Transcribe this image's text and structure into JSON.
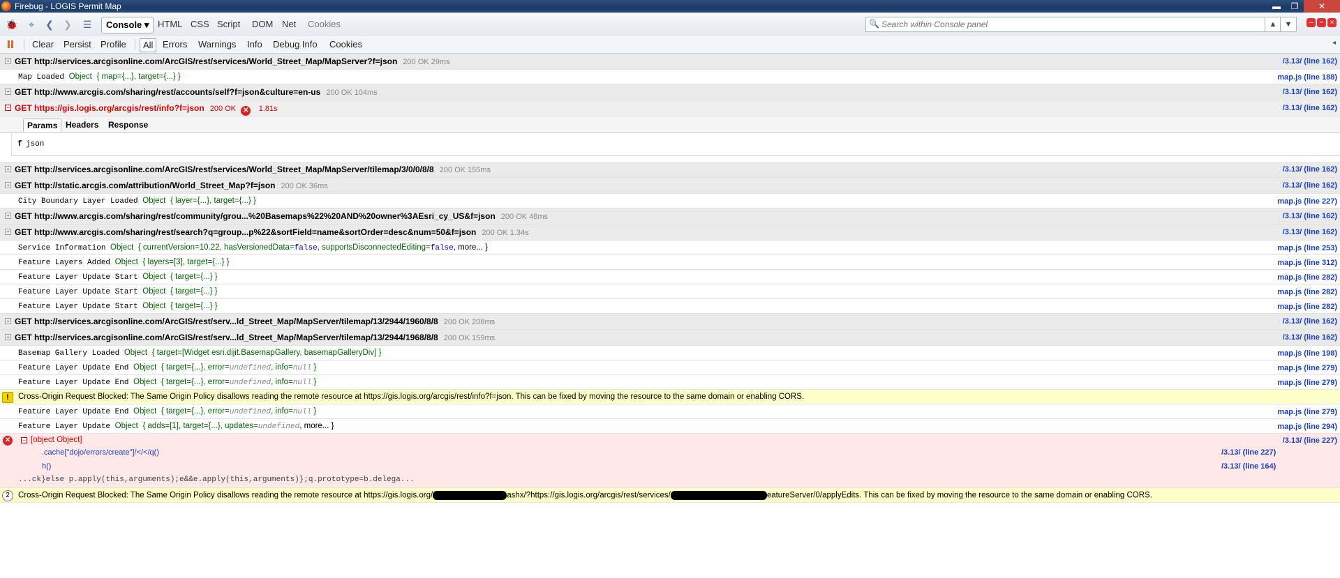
{
  "window": {
    "title": "Firebug - LOGIS Permit Map",
    "min": "▬",
    "max": "❐",
    "close": "✕"
  },
  "toolbar": {
    "tabs": [
      "Console",
      "HTML",
      "CSS",
      "Script",
      "DOM",
      "Net",
      "Cookies"
    ],
    "console_dropdown": "▾",
    "search_placeholder": "Search within Console panel"
  },
  "console_toolbar": {
    "buttons": [
      "Clear",
      "Persist",
      "Profile"
    ],
    "filters": [
      "All",
      "Errors",
      "Warnings",
      "Info",
      "Debug Info",
      "Cookies"
    ]
  },
  "log": {
    "req1": {
      "text": "GET http://services.arcgisonline.com/ArcGIS/rest/services/World_Street_Map/MapServer?f=json",
      "status": "200 OK 29ms",
      "src": "/3.13/ (line 162)"
    },
    "log_map_loaded": {
      "msg": "Map Loaded",
      "obj": "Object",
      "props": "{ map={...}, target={...} }",
      "src": "map.js (line 188)"
    },
    "req2": {
      "text": "GET http://www.arcgis.com/sharing/rest/accounts/self?f=json&culture=en-us",
      "status": "200 OK 104ms",
      "src": "/3.13/ (line 162)"
    },
    "req3": {
      "text": "GET https://gis.logis.org/arcgis/rest/info?f=json",
      "status": "200 OK",
      "time": "1.81s",
      "src": "/3.13/ (line 162)"
    },
    "req3_tabs": [
      "Params",
      "Headers",
      "Response"
    ],
    "req3_param_key": "f",
    "req3_param_val": "json",
    "req4": {
      "text": "GET http://services.arcgisonline.com/ArcGIS/rest/services/World_Street_Map/MapServer/tilemap/3/0/0/8/8",
      "status": "200 OK 155ms",
      "src": "/3.13/ (line 162)"
    },
    "req5": {
      "text": "GET http://static.arcgis.com/attribution/World_Street_Map?f=json",
      "status": "200 OK 36ms",
      "src": "/3.13/ (line 162)"
    },
    "log_city": {
      "msg": "City Boundary Layer Loaded",
      "obj": "Object",
      "props": "{ layer={...}, target={...} }",
      "src": "map.js (line 227)"
    },
    "req6": {
      "text": "GET http://www.arcgis.com/sharing/rest/community/grou...%20Basemaps%22%20AND%20owner%3AEsri_cy_US&f=json",
      "status": "200 OK 48ms",
      "src": "/3.13/ (line 162)"
    },
    "req7": {
      "text": "GET http://www.arcgis.com/sharing/rest/search?q=group...p%22&sortField=name&sortOrder=desc&num=50&f=json",
      "status": "200 OK 1.34s",
      "src": "/3.13/ (line 162)"
    },
    "log_service": {
      "msg": "Service Information",
      "obj": "Object",
      "props_a": "{ currentVersion=10.22, hasVersionedData=",
      "f1": "false",
      "props_b": ", supportsDisconnectedEditing=",
      "f2": "false",
      "more": ", more... }",
      "src": "map.js (line 253)"
    },
    "log_fl_added": {
      "msg": "Feature Layers Added",
      "obj": "Object",
      "props": "{ layers=[3], target={...} }",
      "src": "map.js (line 312)"
    },
    "log_flus1": {
      "msg": "Feature Layer Update Start",
      "obj": "Object",
      "props": "{ target={...} }",
      "src": "map.js (line 282)"
    },
    "log_flus2": {
      "msg": "Feature Layer Update Start",
      "obj": "Object",
      "props": "{ target={...} }",
      "src": "map.js (line 282)"
    },
    "log_flus3": {
      "msg": "Feature Layer Update Start",
      "obj": "Object",
      "props": "{ target={...} }",
      "src": "map.js (line 282)"
    },
    "req8": {
      "text": "GET http://services.arcgisonline.com/ArcGIS/rest/serv...ld_Street_Map/MapServer/tilemap/13/2944/1960/8/8",
      "status": "200 OK 208ms",
      "src": "/3.13/ (line 162)"
    },
    "req9": {
      "text": "GET http://services.arcgisonline.com/ArcGIS/rest/serv...ld_Street_Map/MapServer/tilemap/13/2944/1968/8/8",
      "status": "200 OK 159ms",
      "src": "/3.13/ (line 162)"
    },
    "log_basemap": {
      "msg": "Basemap Gallery Loaded",
      "obj": "Object",
      "props": "{ target=[Widget esri.dijit.BasemapGallery, basemapGalleryDiv] }",
      "src": "map.js (line 198)"
    },
    "log_flue1": {
      "msg": "Feature Layer Update End",
      "obj": "Object",
      "props_a": "{ target={...}, error=",
      "u": "undefined",
      "props_b": ", info=",
      "n": "null",
      "props_c": " }",
      "src": "map.js (line 279)"
    },
    "log_flue2": {
      "msg": "Feature Layer Update End",
      "obj": "Object",
      "props_a": "{ target={...}, error=",
      "u": "undefined",
      "props_b": ", info=",
      "n": "null",
      "props_c": " }",
      "src": "map.js (line 279)"
    },
    "warn1": {
      "text": "Cross-Origin Request Blocked: The Same Origin Policy disallows reading the remote resource at https://gis.logis.org/arcgis/rest/info?f=json. This can be fixed by moving the resource to the same domain or enabling CORS.",
      "icon": "!"
    },
    "log_flue3": {
      "msg": "Feature Layer Update End",
      "obj": "Object",
      "props_a": "{ target={...}, error=",
      "u": "undefined",
      "props_b": ", info=",
      "n": "null",
      "props_c": " }",
      "src": "map.js (line 279)"
    },
    "log_flu": {
      "msg": "Feature Layer Update",
      "obj": "Object",
      "props_a": "{ adds=[1], target={...}, updates=",
      "u": "undefined",
      "more": ", more... }",
      "src": "map.js (line 294)"
    },
    "error": {
      "title": "[object Object]",
      "src": "/3.13/ (line 227)",
      "stack1": ".cache[\"dojo/errors/create\"]/</</q()",
      "stack1_src": "/3.13/ (line 227)",
      "stack2": "h()",
      "stack2_src": "/3.13/ (line 164)",
      "code": "...ck}else p.apply(this,arguments);e&&e.apply(this,arguments)};q.prototype=b.delega..."
    },
    "warn2": {
      "count": "2",
      "part1": "Cross-Origin Request Blocked: The Same Origin Policy disallows reading the remote resource at https://gis.logis.org/",
      "part2": "ashx/?https://gis.logis.org/arcgis/rest/services/",
      "part3": "eatureServer/0/applyEdits. This can be fixed by moving the resource to the same domain or enabling CORS."
    }
  },
  "colors": {
    "link": "#1a3fbf",
    "error_bg": "#ffe8e8",
    "warning_bg": "#ffffc9",
    "request_bg": "#eaeaea"
  }
}
